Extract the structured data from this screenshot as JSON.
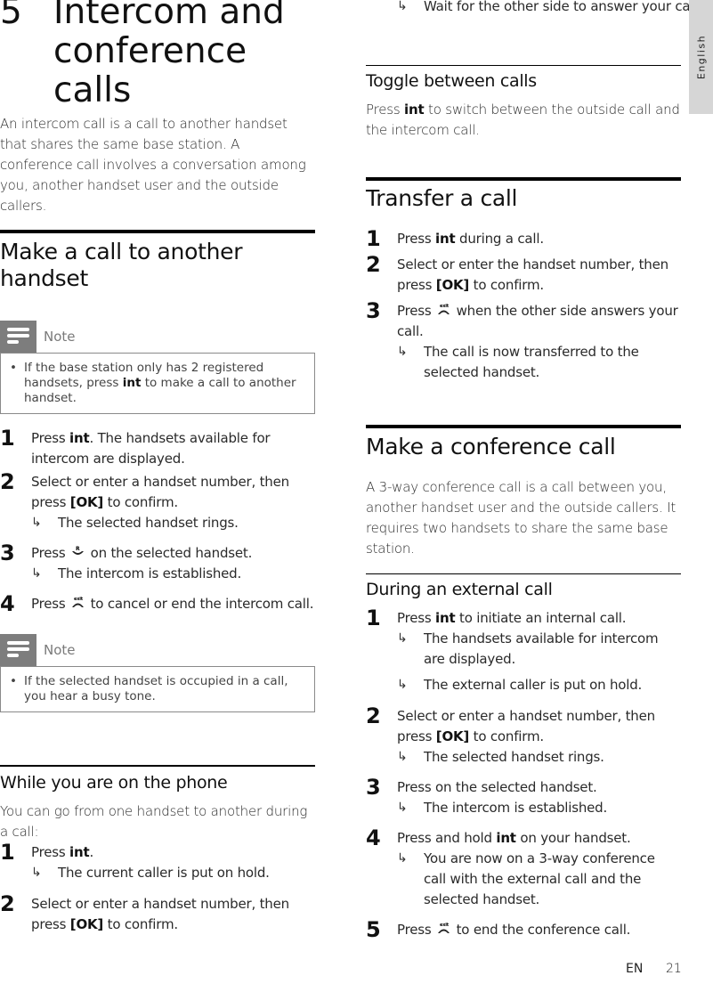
{
  "chapter": {
    "number": "5",
    "title": "Intercom and conference calls",
    "intro": "An intercom call is a call to another handset that shares the same base station. A conference call involves a conversation among you, another handset user and the outside callers."
  },
  "make_call": {
    "heading": "Make a call to another handset",
    "note1": {
      "label": "Note",
      "text_before": "If the base station only has 2 registered handsets, press ",
      "keyword": "int",
      "text_after": " to make a call to another handset."
    },
    "steps": [
      {
        "num": "1",
        "pre": "Press ",
        "kw": "int",
        "post": ". The handsets available for intercom are displayed."
      },
      {
        "num": "2",
        "pre": "Select or enter a handset number, then press ",
        "kw": "[OK]",
        "post": " to confirm.",
        "result": "The selected handset rings."
      },
      {
        "num": "3",
        "pre": "Press ",
        "icon": "talk-icon",
        "post": " on the selected handset.",
        "result": "The intercom is established."
      },
      {
        "num": "4",
        "pre": "Press ",
        "icon": "end-call-exit-icon",
        "post": " to cancel or end the intercom call."
      }
    ],
    "note2": {
      "label": "Note",
      "text": "If the selected handset is occupied in a call, you hear a busy tone."
    }
  },
  "while_on_phone": {
    "heading": "While you are on the phone",
    "intro": "You can go from one handset to another during a call:",
    "steps": [
      {
        "num": "1",
        "pre": "Press ",
        "kw": "int",
        "post": ".",
        "result": "The current caller is put on hold."
      },
      {
        "num": "2",
        "pre": "Select or enter a handset number, then press ",
        "kw": "[OK]",
        "post": " to confirm.",
        "result": "Wait for the other side to answer your call."
      }
    ]
  },
  "toggle": {
    "heading": "Toggle between calls",
    "pre": "Press ",
    "kw": "int",
    "post": " to switch between the outside call and the intercom call."
  },
  "transfer": {
    "heading": "Transfer a call",
    "steps": [
      {
        "num": "1",
        "pre": "Press ",
        "kw": "int",
        "post": " during a call."
      },
      {
        "num": "2",
        "pre": "Select or enter the handset number, then press ",
        "kw": "[OK]",
        "post": " to confirm."
      },
      {
        "num": "3",
        "pre": "Press ",
        "icon": "end-call-exit-icon",
        "post": " when the other side answers your call.",
        "result": "The call is now transferred to the selected handset."
      }
    ]
  },
  "conference": {
    "heading": "Make a conference call",
    "intro": "A 3-way conference call is a call between you, another handset user and the outside callers. It requires two handsets to share the same base station.",
    "sub_heading": "During an external call",
    "steps": [
      {
        "num": "1",
        "pre": "Press ",
        "kw": "int",
        "post": " to initiate an internal call.",
        "results": [
          "The handsets available for intercom are displayed.",
          "The external caller is put on hold."
        ]
      },
      {
        "num": "2",
        "pre": "Select or enter a handset number, then press ",
        "kw": "[OK]",
        "post": " to confirm.",
        "result": "The selected handset rings."
      },
      {
        "num": "3",
        "pre": "Press on the selected handset.",
        "result": "The intercom is established."
      },
      {
        "num": "4",
        "pre": "Press and hold ",
        "kw": "int",
        "post": " on your handset.",
        "result": "You are now on a 3-way conference call with the external call and the selected handset."
      },
      {
        "num": "5",
        "pre": "Press ",
        "icon": "end-call-exit-icon",
        "post": " to end the conference call."
      }
    ]
  },
  "side_tab": {
    "label": "English"
  },
  "footer": {
    "lang": "EN",
    "page": "21"
  },
  "result_arrow": "↳"
}
